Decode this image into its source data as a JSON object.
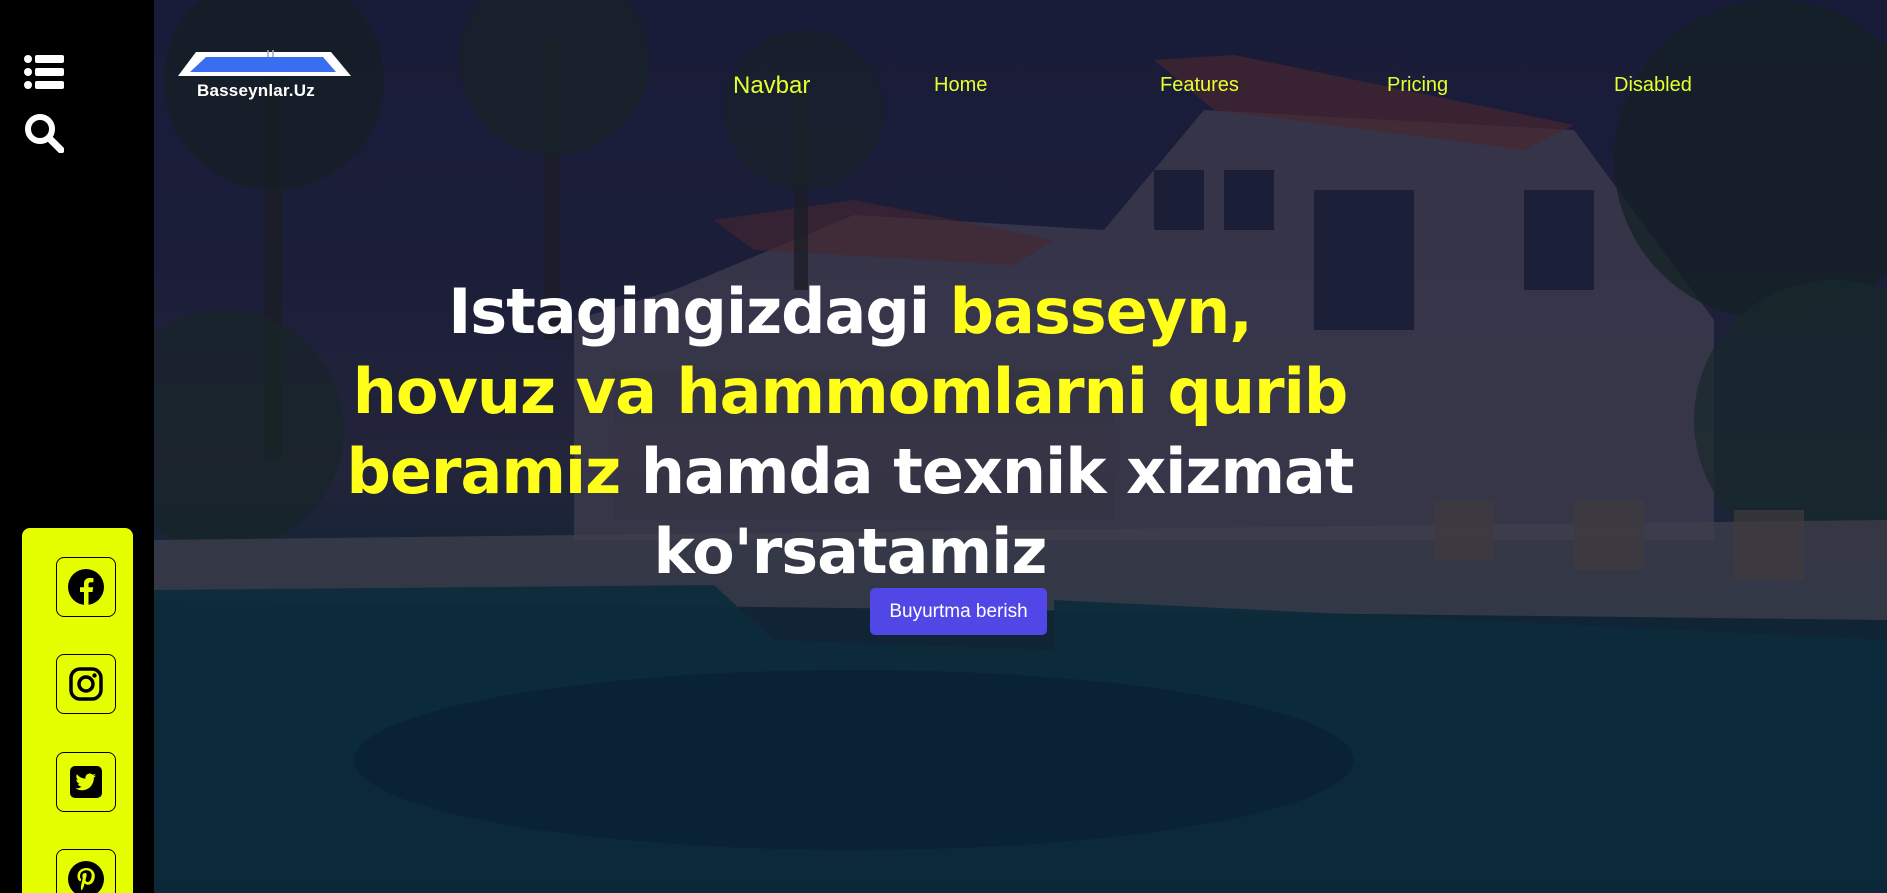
{
  "sidebar": {
    "menu_icon": "list-icon",
    "search_icon": "search-icon",
    "social": [
      {
        "name": "facebook-icon"
      },
      {
        "name": "instagram-icon"
      },
      {
        "name": "twitter-icon"
      },
      {
        "name": "pinterest-icon"
      }
    ],
    "panel_color": "#e6ff00"
  },
  "navbar": {
    "logo_text": "Basseynlar.Uz",
    "brand": "Navbar",
    "links": [
      "Home",
      "Features",
      "Pricing",
      "Disabled"
    ],
    "link_color": "#e6ff2e"
  },
  "hero": {
    "headline": {
      "part1": "Istagingizdagi ",
      "highlight1": "basseyn, hovuz va hammomlarni qurib beramiz",
      "part2": " hamda texnik xizmat ko'rsatamiz"
    },
    "highlight_color": "#ffff1a",
    "cta_label": "Buyurtma berish",
    "cta_color": "#5146e6"
  }
}
